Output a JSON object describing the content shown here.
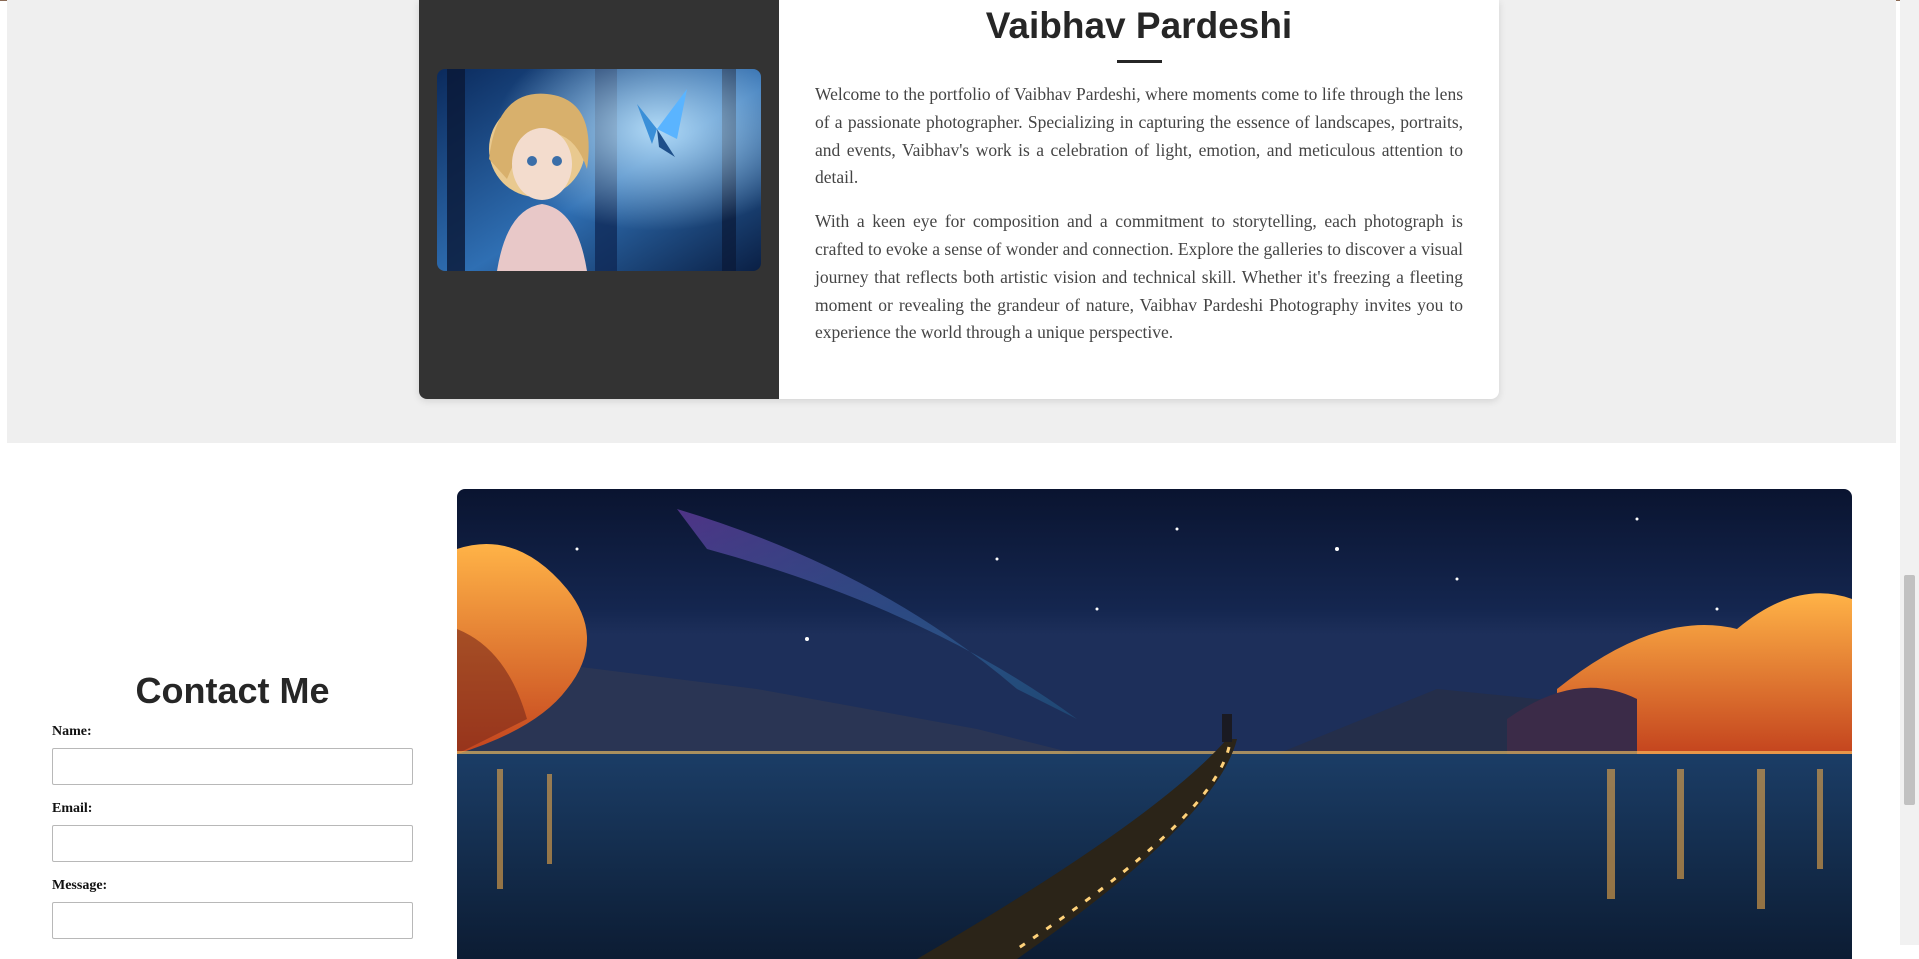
{
  "about": {
    "title": "Vaibhav Pardeshi",
    "photo_icon": "anime-girl-butterfly-image",
    "paragraphs": [
      "Welcome to the portfolio of Vaibhav Pardeshi, where moments come to life through the lens of a passionate photographer. Specializing in capturing the essence of landscapes, portraits, and events, Vaibhav's work is a celebration of light, emotion, and meticulous attention to detail.",
      "With a keen eye for composition and a commitment to storytelling, each photograph is crafted to evoke a sense of wonder and connection. Explore the galleries to discover a visual journey that reflects both artistic vision and technical skill. Whether it's freezing a fleeting moment or revealing the grandeur of nature, Vaibhav Pardeshi Photography invites you to experience the world through a unique perspective."
    ]
  },
  "contact": {
    "title": "Contact Me",
    "name_label": "Name:",
    "name_value": "",
    "email_label": "Email:",
    "email_value": "",
    "message_label": "Message:",
    "message_value": ""
  },
  "hero": {
    "image_icon": "night-lake-landscape-image"
  },
  "colors": {
    "dark_panel": "#333333",
    "section_bg": "#efefef",
    "heading": "#262626"
  }
}
